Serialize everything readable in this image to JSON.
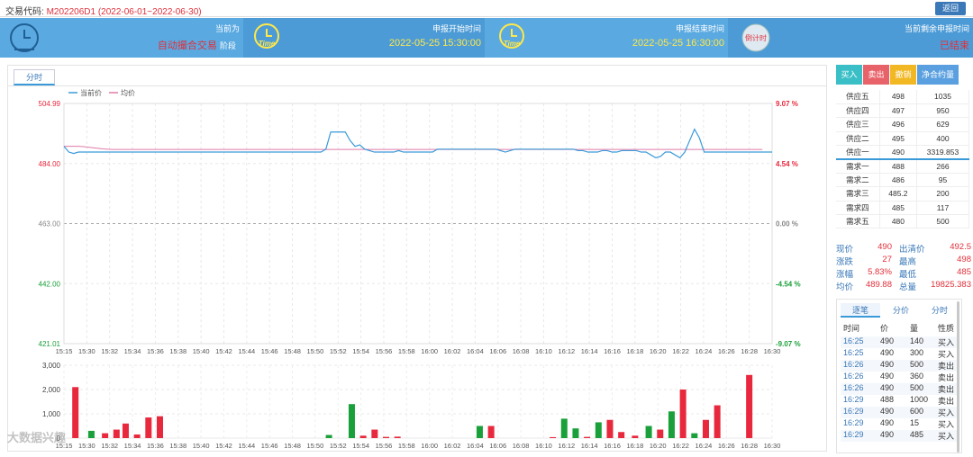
{
  "header": {
    "label": "交易代码:",
    "code": "M202206D1 (2022-06-01~2022-06-30)",
    "back_label": "返回"
  },
  "banner": {
    "status_title": "当前为",
    "status_value": "自动撮合交易",
    "status_suffix": "阶段",
    "start_title": "申报开始时间",
    "start_value": "2022-05-25 15:30:00",
    "end_title": "申报结束时间",
    "end_value": "2022-05-25 16:30:00",
    "remain_title": "当前剩余申报时间",
    "remain_value": "已结束",
    "time_icon_text": "Time",
    "countdown_icon_text": "倒计时"
  },
  "colors": {
    "accent": "#3a9ad9",
    "up": "#e8283c",
    "down": "#1aa03a",
    "price_line": "#3a9ad9",
    "avg_line": "#e07aa8"
  },
  "chart_tab": "分时",
  "chart_data": {
    "type": "line",
    "legend": [
      "当前价",
      "均价"
    ],
    "y_left": [
      "504.99",
      "484.00",
      "463.00",
      "442.00",
      "421.01"
    ],
    "y_right": [
      "9.07 %",
      "4.54 %",
      "0.00 %",
      "-4.54 %",
      "-9.07 %"
    ],
    "ylim": [
      421.01,
      504.99
    ],
    "base_price": 463.0,
    "x_labels": [
      "15:15",
      "15:30",
      "15:32",
      "15:34",
      "15:36",
      "15:38",
      "15:40",
      "15:42",
      "15:44",
      "15:46",
      "15:48",
      "15:50",
      "15:52",
      "15:54",
      "15:56",
      "15:58",
      "16:00",
      "16:02",
      "16:04",
      "16:06",
      "16:08",
      "16:10",
      "16:12",
      "16:14",
      "16:16",
      "16:18",
      "16:20",
      "16:22",
      "16:24",
      "16:26",
      "16:28",
      "16:30"
    ],
    "price": [
      490,
      488,
      487.5,
      488,
      488,
      488,
      488,
      488,
      488,
      488,
      488,
      488,
      488,
      488,
      488,
      488,
      488,
      488,
      488,
      488,
      488,
      488,
      488,
      488,
      488,
      488,
      488,
      488,
      488,
      488,
      488,
      488,
      488,
      488,
      488,
      488,
      488,
      488,
      488,
      488,
      488,
      488,
      488,
      488,
      488,
      488,
      488,
      488,
      488,
      488,
      488,
      488,
      488,
      488,
      489,
      495,
      495,
      495,
      495,
      492,
      490,
      490.5,
      489,
      488.5,
      488,
      488,
      488,
      488,
      488,
      488.5,
      488,
      488,
      488,
      488,
      488,
      488,
      488,
      489,
      489,
      489,
      489,
      489,
      489,
      489,
      489,
      489,
      489,
      489,
      489,
      489,
      488.5,
      488,
      488.5,
      489,
      489,
      489,
      489,
      489,
      489,
      489,
      489,
      489,
      489,
      489,
      489,
      489,
      488.5,
      488.5,
      488,
      488,
      488,
      488.5,
      488.5,
      488,
      488,
      488.5,
      488.5,
      488.5,
      488.5,
      488,
      488,
      487,
      486,
      486.5,
      488,
      488,
      487,
      486,
      488,
      492,
      496,
      493,
      488,
      488,
      488,
      488,
      488,
      488,
      488,
      488,
      488,
      488,
      488,
      488,
      488,
      488,
      488
    ],
    "avg": [
      490,
      490,
      490,
      490,
      489.9,
      489.7,
      489.5,
      489.3,
      489.1,
      489,
      488.9,
      488.9,
      488.9,
      488.9,
      488.9,
      488.9,
      488.9,
      488.9,
      488.9,
      488.9,
      488.9,
      488.9,
      488.9,
      488.9,
      488.9,
      488.9,
      488.9,
      488.9,
      488.9,
      488.9,
      488.9,
      488.9,
      488.9,
      488.9,
      488.9,
      488.9,
      488.9,
      488.9,
      488.9,
      488.9,
      488.9,
      488.9,
      488.9,
      488.9,
      488.9,
      488.9,
      488.9,
      488.9,
      488.9,
      488.9,
      488.9,
      488.9,
      488.9,
      488.9,
      488.9,
      488.9,
      488.9,
      488.9,
      488.9,
      488.9,
      488.9,
      488.9,
      488.9,
      488.9,
      488.9,
      488.9,
      488.9,
      488.9,
      488.9,
      488.9,
      488.9,
      488.9,
      488.9,
      488.9,
      488.9,
      488.9,
      488.9,
      488.9,
      488.9,
      488.9,
      488.9,
      488.9,
      488.9,
      488.9,
      488.9,
      488.9,
      488.9,
      488.9,
      488.9,
      488.9,
      488.9,
      488.9,
      488.9,
      488.9,
      488.9,
      488.9,
      488.9,
      488.9,
      488.9,
      488.9,
      488.9,
      488.9,
      488.9,
      488.9,
      488.9,
      488.9,
      488.9,
      488.9,
      488.9,
      488.9,
      488.9,
      488.9,
      488.9,
      488.9,
      488.9,
      488.9,
      488.9,
      488.9,
      488.9,
      488.9,
      488.9,
      488.9,
      488.9,
      488.9,
      488.9,
      488.9,
      488.9,
      488.9,
      488.9,
      488.9,
      488.9,
      488.9,
      488.9,
      488.9,
      488.9,
      488.9,
      488.9,
      488.9,
      488.9,
      488.9,
      488.9,
      488.9,
      488.9,
      488.9,
      488.9
    ],
    "vol_axis": [
      "3,000",
      "2,000",
      "1,000",
      "0"
    ],
    "vol_max": 3000,
    "volumes": [
      {
        "x": 0.5,
        "v": 2100,
        "up": true
      },
      {
        "x": 1.2,
        "v": 300,
        "up": false
      },
      {
        "x": 1.8,
        "v": 200,
        "up": true
      },
      {
        "x": 2.3,
        "v": 350,
        "up": true
      },
      {
        "x": 2.7,
        "v": 600,
        "up": true
      },
      {
        "x": 3.2,
        "v": 150,
        "up": true
      },
      {
        "x": 3.7,
        "v": 850,
        "up": true
      },
      {
        "x": 4.2,
        "v": 900,
        "up": true
      },
      {
        "x": 11.6,
        "v": 130,
        "up": false
      },
      {
        "x": 12.6,
        "v": 1400,
        "up": false
      },
      {
        "x": 13.1,
        "v": 100,
        "up": true
      },
      {
        "x": 13.6,
        "v": 350,
        "up": true
      },
      {
        "x": 14.1,
        "v": 50,
        "up": true
      },
      {
        "x": 14.6,
        "v": 60,
        "up": true
      },
      {
        "x": 18.2,
        "v": 500,
        "up": false
      },
      {
        "x": 18.7,
        "v": 500,
        "up": true
      },
      {
        "x": 21.4,
        "v": 40,
        "up": true
      },
      {
        "x": 21.9,
        "v": 800,
        "up": false
      },
      {
        "x": 22.4,
        "v": 400,
        "up": false
      },
      {
        "x": 22.9,
        "v": 50,
        "up": true
      },
      {
        "x": 23.4,
        "v": 650,
        "up": false
      },
      {
        "x": 23.9,
        "v": 750,
        "up": true
      },
      {
        "x": 24.4,
        "v": 250,
        "up": true
      },
      {
        "x": 25.0,
        "v": 100,
        "up": true
      },
      {
        "x": 25.6,
        "v": 500,
        "up": false
      },
      {
        "x": 26.1,
        "v": 350,
        "up": true
      },
      {
        "x": 26.6,
        "v": 1100,
        "up": false
      },
      {
        "x": 27.1,
        "v": 2000,
        "up": true
      },
      {
        "x": 27.6,
        "v": 200,
        "up": false
      },
      {
        "x": 28.1,
        "v": 750,
        "up": true
      },
      {
        "x": 28.6,
        "v": 1350,
        "up": true
      },
      {
        "x": 30.0,
        "v": 2600,
        "up": true
      }
    ]
  },
  "actions": {
    "buy": "买入",
    "sell": "卖出",
    "cancel": "撤销",
    "net": "净合约量"
  },
  "orderbook": [
    {
      "label": "供应五",
      "price": "498",
      "qty": "1035"
    },
    {
      "label": "供应四",
      "price": "497",
      "qty": "950"
    },
    {
      "label": "供应三",
      "price": "496",
      "qty": "629"
    },
    {
      "label": "供应二",
      "price": "495",
      "qty": "400"
    },
    {
      "label": "供应一",
      "price": "490",
      "qty": "3319.853"
    },
    {
      "label": "需求一",
      "price": "488",
      "qty": "266"
    },
    {
      "label": "需求二",
      "price": "486",
      "qty": "95"
    },
    {
      "label": "需求三",
      "price": "485.2",
      "qty": "200"
    },
    {
      "label": "需求四",
      "price": "485",
      "qty": "117"
    },
    {
      "label": "需求五",
      "price": "480",
      "qty": "500"
    }
  ],
  "stats": [
    {
      "l1": "现价",
      "v1": "490",
      "l2": "出清价",
      "v2": "492.5"
    },
    {
      "l1": "涨跌",
      "v1": "27",
      "l2": "最高",
      "v2": "498"
    },
    {
      "l1": "涨幅",
      "v1": "5.83%",
      "l2": "最低",
      "v2": "485"
    },
    {
      "l1": "均价",
      "v1": "489.88",
      "l2": "总量",
      "v2": "19825.383"
    }
  ],
  "trade_tabs": [
    "逐笔",
    "分价",
    "分时"
  ],
  "trade_headers": [
    "时间",
    "价",
    "量",
    "性质"
  ],
  "trades": [
    {
      "t": "16:25",
      "p": "490",
      "q": "140",
      "s": "买入"
    },
    {
      "t": "16:25",
      "p": "490",
      "q": "300",
      "s": "买入"
    },
    {
      "t": "16:26",
      "p": "490",
      "q": "500",
      "s": "卖出"
    },
    {
      "t": "16:26",
      "p": "490",
      "q": "360",
      "s": "卖出"
    },
    {
      "t": "16:26",
      "p": "490",
      "q": "500",
      "s": "卖出"
    },
    {
      "t": "16:29",
      "p": "488",
      "q": "1000",
      "s": "卖出"
    },
    {
      "t": "16:29",
      "p": "490",
      "q": "600",
      "s": "买入"
    },
    {
      "t": "16:29",
      "p": "490",
      "q": "15",
      "s": "买入"
    },
    {
      "t": "16:29",
      "p": "490",
      "q": "485",
      "s": "买入"
    }
  ],
  "watermark": "大数据兴趣"
}
